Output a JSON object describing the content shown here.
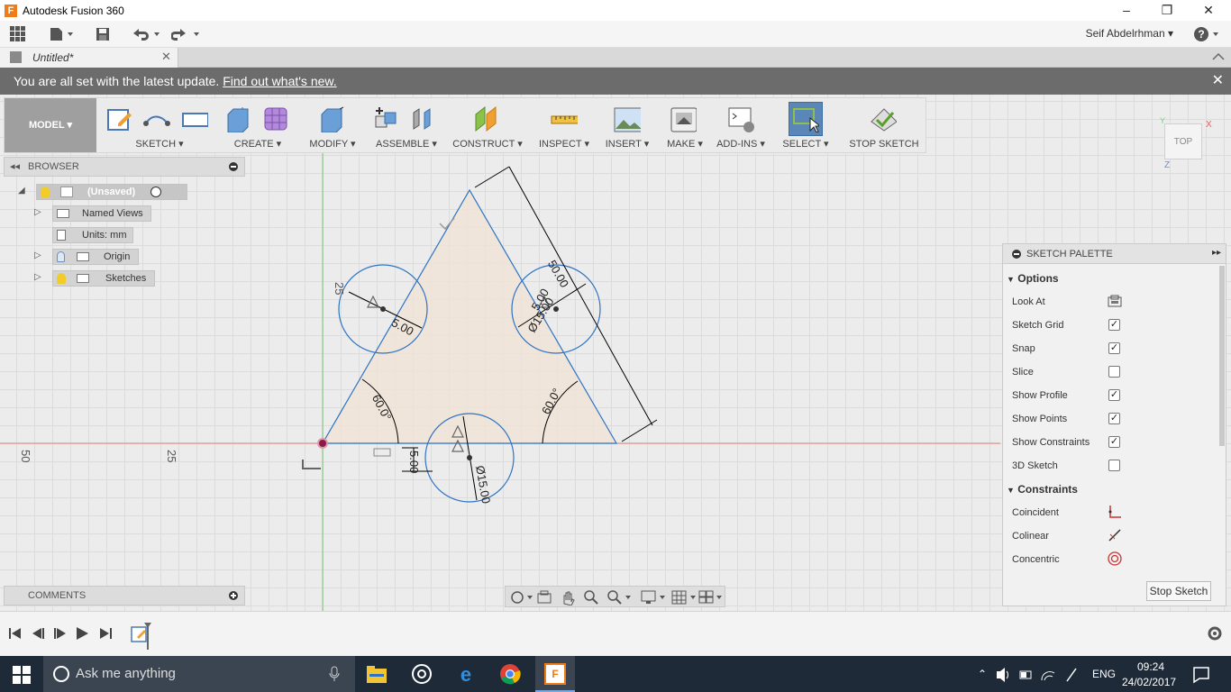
{
  "window": {
    "title": "Autodesk Fusion 360",
    "minimize": "–",
    "maximize": "❐",
    "close": "✕"
  },
  "user": {
    "name": "Seif Abdelrhman ▾"
  },
  "tab": {
    "label": "Untitled*",
    "close": "✕"
  },
  "banner": {
    "text": "You are all set with the latest update. ",
    "link": "Find out what's new.",
    "close": "✕"
  },
  "ribbon": {
    "workspace": "MODEL ▾",
    "groups": [
      "SKETCH ▾",
      "CREATE ▾",
      "MODIFY ▾",
      "ASSEMBLE ▾",
      "CONSTRUCT ▾",
      "INSPECT ▾",
      "INSERT ▾",
      "MAKE ▾",
      "ADD-INS ▾",
      "SELECT ▾",
      "STOP SKETCH"
    ]
  },
  "browser": {
    "title": "BROWSER",
    "items": [
      {
        "label": "(Unsaved)"
      },
      {
        "label": "Named Views"
      },
      {
        "label": "Units: mm"
      },
      {
        "label": "Origin"
      },
      {
        "label": "Sketches"
      }
    ]
  },
  "comments": {
    "title": "COMMENTS"
  },
  "viewcube": {
    "label": "TOP",
    "axis_x": "X",
    "axis_y": "Y",
    "axis_z": "Z"
  },
  "sketch": {
    "dims": {
      "side": "50.00",
      "angle1": "60.0°",
      "angle2": "60.0°",
      "offset": "5.00",
      "dia_top_left": "5.00",
      "dia_top_right": "Ø15.00",
      "dia_bottom": "Ø15.00",
      "right_small": "5.00"
    },
    "axis_labels": {
      "h50": "50",
      "h25": "25",
      "v25": "25"
    }
  },
  "palette": {
    "title": "SKETCH PALETTE",
    "options_title": "Options",
    "options": [
      {
        "label": "Look At",
        "type": "icon"
      },
      {
        "label": "Sketch Grid",
        "checked": true
      },
      {
        "label": "Snap",
        "checked": true
      },
      {
        "label": "Slice",
        "checked": false
      },
      {
        "label": "Show Profile",
        "checked": true
      },
      {
        "label": "Show Points",
        "checked": true
      },
      {
        "label": "Show Constraints",
        "checked": true
      },
      {
        "label": "3D Sketch",
        "checked": false
      }
    ],
    "constraints_title": "Constraints",
    "constraints": [
      {
        "label": "Coincident",
        "icon": "coincident-icon"
      },
      {
        "label": "Colinear",
        "icon": "colinear-icon"
      },
      {
        "label": "Concentric",
        "icon": "concentric-icon"
      }
    ],
    "stop_button": "Stop Sketch"
  },
  "taskbar": {
    "search_placeholder": "Ask me anything",
    "language": "ENG",
    "time": "09:24",
    "date": "24/02/2017"
  },
  "colors": {
    "accent": "#2d73c4",
    "profile": "#f1e4d6",
    "model_button": "#9f9f9f",
    "taskbar": "#1f2a38"
  }
}
